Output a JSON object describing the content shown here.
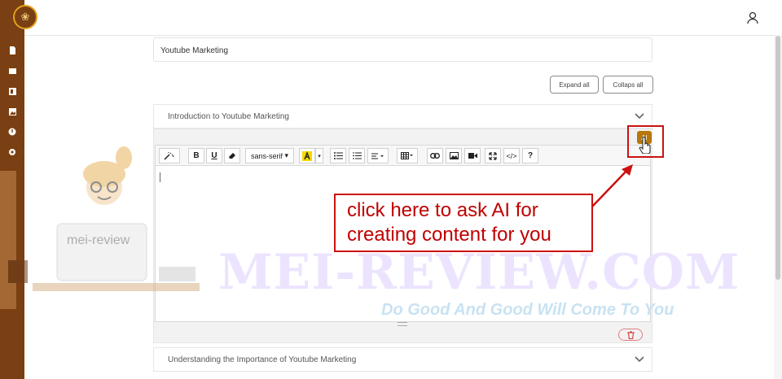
{
  "topic_title": "Youtube Marketing",
  "actions": {
    "expand_all": "Expand all",
    "collapse_all": "Collaps all"
  },
  "sections": [
    {
      "label": "Introduction to Youtube Marketing"
    },
    {
      "label": "Understanding the Importance of Youtube Marketing"
    }
  ],
  "toolbar": {
    "font": "sans-serif",
    "bold": "B",
    "underline": "U",
    "help": "?",
    "code": "</>"
  },
  "ai_button": {
    "label": "AI"
  },
  "callout": {
    "line1": "click here to ask AI for",
    "line2": "creating content for you"
  },
  "watermark": {
    "brand": "MEI-REVIEW.COM",
    "tagline": "Do Good And Good Will Come To You",
    "mascot_text": "mei-review"
  },
  "colors": {
    "sidebar": "#7a3f12",
    "accent": "#b7770d",
    "highlight": "#cc1111"
  }
}
